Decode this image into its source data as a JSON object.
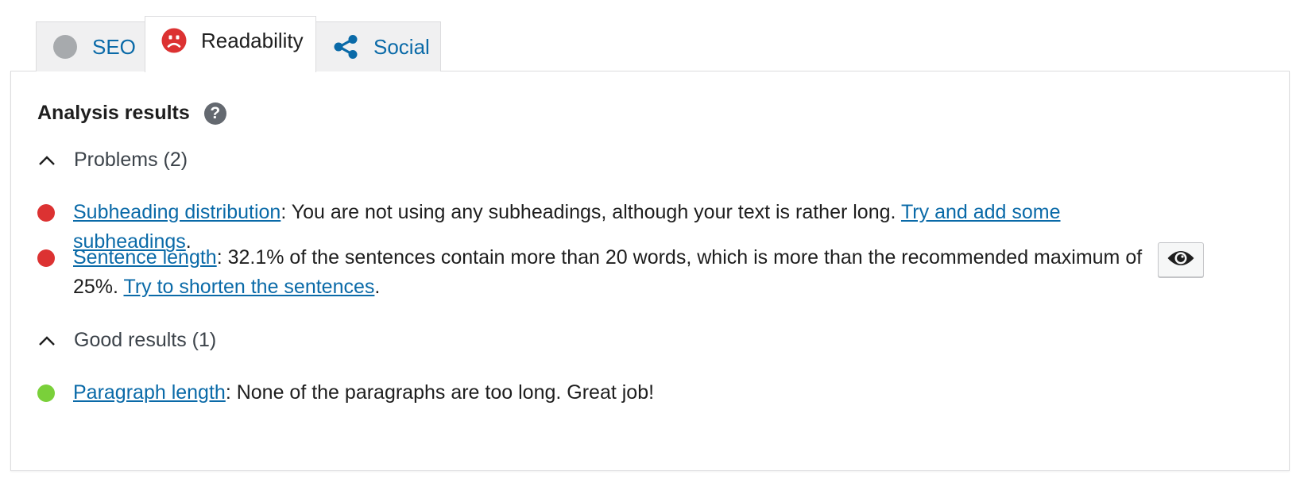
{
  "colors": {
    "bad": "#dc3232",
    "good": "#7ad03a",
    "neutral": "#a7aaad",
    "link": "#0a6aa8"
  },
  "tabs": [
    {
      "label": "SEO",
      "icon": "grey-dot-icon",
      "active": false
    },
    {
      "label": "Readability",
      "icon": "sad-face-icon",
      "active": true
    },
    {
      "label": "Social",
      "icon": "share-icon",
      "active": false
    }
  ],
  "panel": {
    "heading": "Analysis results",
    "help_icon_label": "?",
    "problems": {
      "label": "Problems (2)",
      "items": [
        {
          "status": "bad",
          "title": "Subheading distribution",
          "text": ": You are not using any subheadings, although your text is rather long. ",
          "action": "Try and add some subheadings",
          "end": "."
        },
        {
          "status": "bad",
          "title": "Sentence length",
          "text": ": 32.1% of the sentences contain more than 20 words, which is more than the recommended maximum of 25%. ",
          "action": "Try to shorten the sentences",
          "end": "."
        }
      ]
    },
    "good": {
      "label": "Good results (1)",
      "items": [
        {
          "status": "good",
          "title": "Paragraph length",
          "text": ": None of the paragraphs are too long. Great job!"
        }
      ]
    }
  }
}
